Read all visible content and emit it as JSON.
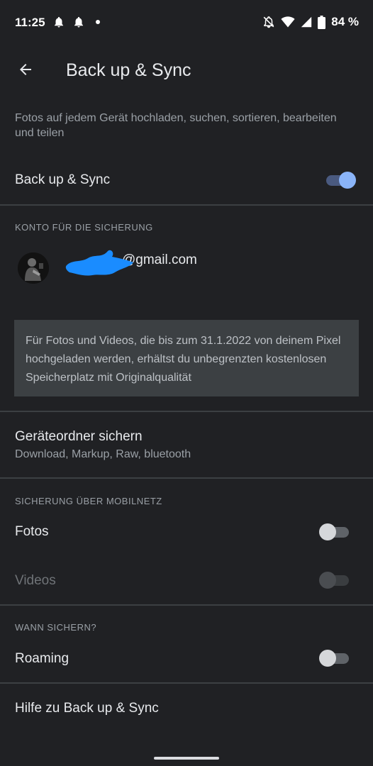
{
  "status_bar": {
    "time": "11:25",
    "battery": "84 %",
    "icons": [
      "bell-icon",
      "bell-icon",
      "dot-icon",
      "bell-off-icon",
      "wifi-icon",
      "cell-signal-icon",
      "battery-icon"
    ]
  },
  "app_bar": {
    "title": "Back up & Sync",
    "back_icon": "arrow-back-icon"
  },
  "intro_text": "Fotos auf jedem Gerät hochladen, suchen, sortieren, bearbeiten und teilen",
  "backup_sync": {
    "label": "Back up & Sync",
    "enabled": true
  },
  "account_section": {
    "header": "KONTO FÜR DIE SICHERUNG",
    "email": "@gmail.com",
    "info": "Für Fotos und Videos, die bis zum 31.1.2022 von deinem Pixel hochgeladen werden, erhältst du unbegrenzten kostenlosen Speicherplatz mit Originalqualität"
  },
  "device_folders": {
    "title": "Geräteordner sichern",
    "subtitle": "Download, Markup, Raw, bluetooth"
  },
  "mobile_section": {
    "header": "SICHERUNG ÜBER MOBILNETZ",
    "photos_label": "Fotos",
    "photos_enabled": false,
    "videos_label": "Videos",
    "videos_enabled": false
  },
  "when_section": {
    "header": "WANN SICHERN?",
    "roaming_label": "Roaming",
    "roaming_enabled": false
  },
  "help": {
    "label": "Hilfe zu Back up & Sync"
  },
  "colors": {
    "background": "#202124",
    "accent": "#8ab4f8",
    "divider": "#3c4043",
    "redaction": "#1a8cff"
  }
}
